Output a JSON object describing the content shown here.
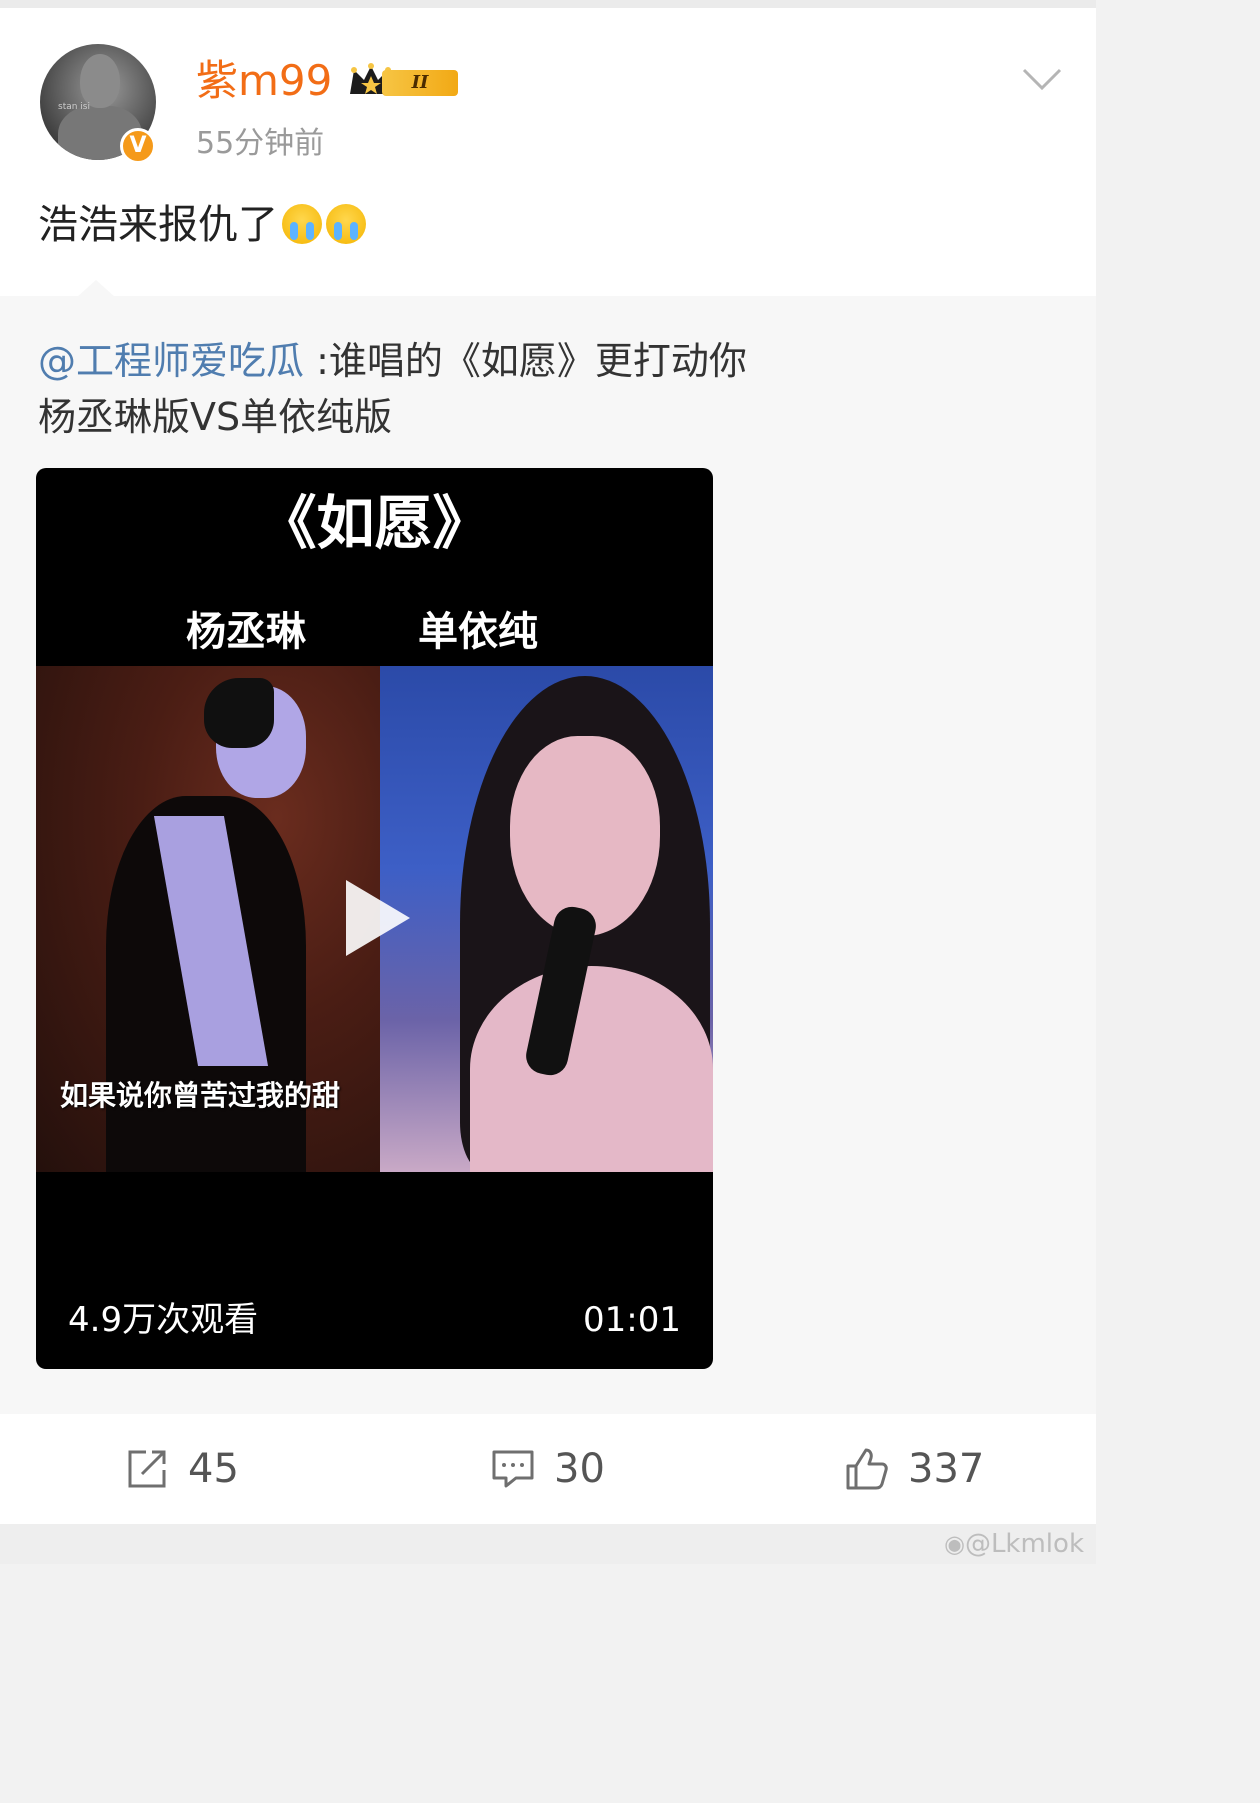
{
  "post": {
    "username": "紫m99",
    "avatar_text": "stan isi",
    "verified_badge": "V",
    "level_badge": "II",
    "timestamp": "55分钟前",
    "text": "浩浩来报仇了",
    "emojis": [
      "crying-face",
      "crying-face"
    ]
  },
  "repost": {
    "mention": "@工程师爱吃瓜",
    "text_line1": " :谁唱的《如愿》更打动你",
    "text_line2": "杨丞琳版VS单依纯版",
    "video": {
      "title": "《如愿》",
      "left_name": "杨丞琳",
      "right_name": "单依纯",
      "subtitle": "如果说你曾苦过我的甜",
      "views": "4.9万次观看",
      "duration": "01:01"
    }
  },
  "actions": {
    "repost_count": "45",
    "comment_count": "30",
    "like_count": "337"
  },
  "watermark": "@Lkmlok",
  "colors": {
    "username": "#f26d16",
    "mention": "#507daf",
    "vbadge": "#f59a1a"
  }
}
